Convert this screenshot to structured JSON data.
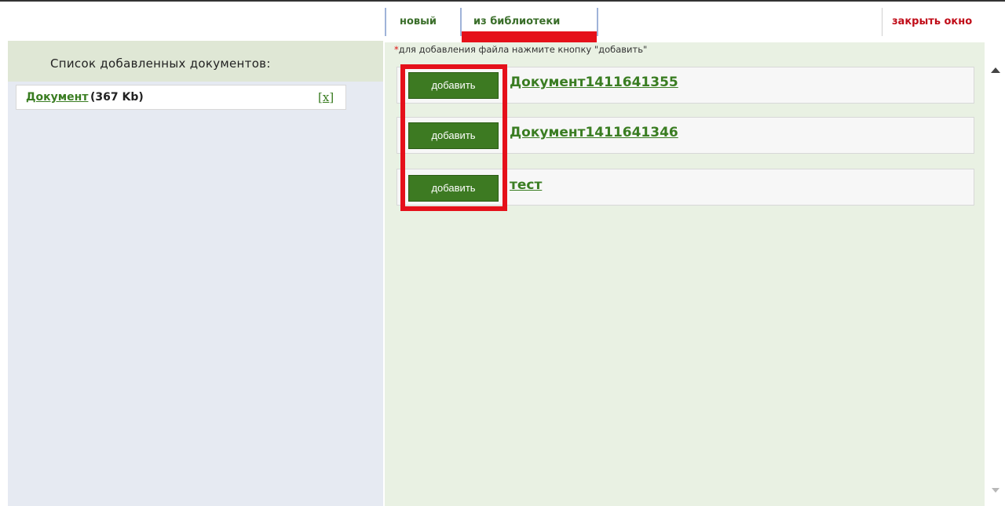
{
  "tabs": {
    "new_label": "новый",
    "library_label": "из библиотеки",
    "close_label": "закрыть окно"
  },
  "left": {
    "title": "Список добавленных документов:",
    "doc": {
      "name": "Документ",
      "size": "(367 Kb)",
      "remove_label": "x"
    }
  },
  "right": {
    "hint_star": "*",
    "hint": "для добавления файла нажмите кнопку \"добавить\"",
    "items": [
      {
        "button": "добавить",
        "name": "Документ1411641355"
      },
      {
        "button": "добавить",
        "name": "Документ1411641346"
      },
      {
        "button": "добавить",
        "name": "тест"
      }
    ]
  },
  "colors": {
    "accent_green": "#3d7a22",
    "highlight_red": "#e5101a",
    "close_red": "#c00c18"
  },
  "icons": [
    "scroll-up-icon",
    "scroll-down-icon"
  ]
}
